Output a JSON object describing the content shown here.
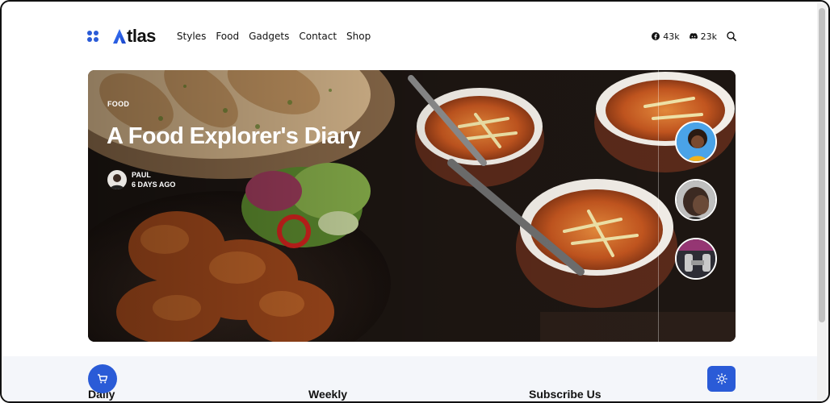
{
  "brand": {
    "name": "tlas"
  },
  "nav": {
    "items": [
      {
        "label": "Styles"
      },
      {
        "label": "Food"
      },
      {
        "label": "Gadgets"
      },
      {
        "label": "Contact"
      },
      {
        "label": "Shop"
      }
    ]
  },
  "social": {
    "facebook_count": "43k",
    "discord_count": "23k"
  },
  "hero": {
    "category": "FOOD",
    "title": "A Food Explorer's Diary",
    "author": "PAUL",
    "time_ago": "6 DAYS AGO"
  },
  "sections": {
    "col1": "Daily",
    "col2": "Weekly",
    "col3": "Subscribe Us"
  },
  "colors": {
    "accent": "#2a5bd7",
    "text": "#111111",
    "bottom_bg": "#f4f6fa"
  },
  "icons": {
    "menu": "grid-icon",
    "facebook": "facebook-icon",
    "discord": "discord-icon",
    "search": "search-icon",
    "cart": "cart-icon",
    "theme": "sun-icon"
  }
}
